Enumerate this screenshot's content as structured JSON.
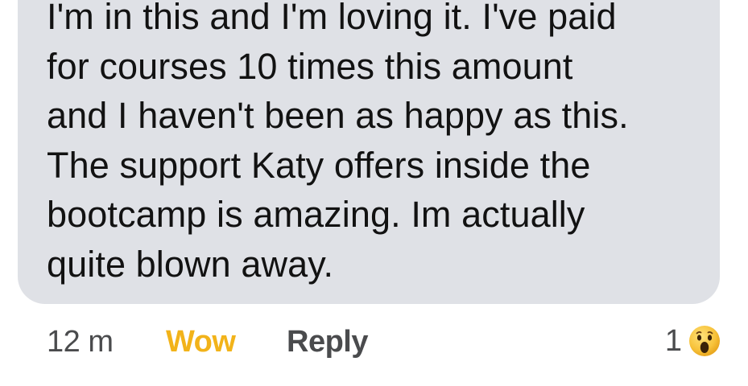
{
  "comment": {
    "lines": [
      "I'm in this and I'm loving it. I've paid",
      "for courses 10 times this amount",
      "and I haven't been as happy as this.",
      "The support Katy offers inside the",
      "bootcamp is amazing. Im actually",
      "quite blown away."
    ]
  },
  "meta": {
    "timestamp": "12 m",
    "wow_label": "Wow",
    "reply_label": "Reply",
    "reaction_count": "1",
    "reaction_icon": "wow-emoji-icon"
  },
  "colors": {
    "bubble": "#dfe1e6",
    "text": "#121212",
    "meta_text": "#4a4b4d",
    "wow_accent": "#f2b31a"
  }
}
